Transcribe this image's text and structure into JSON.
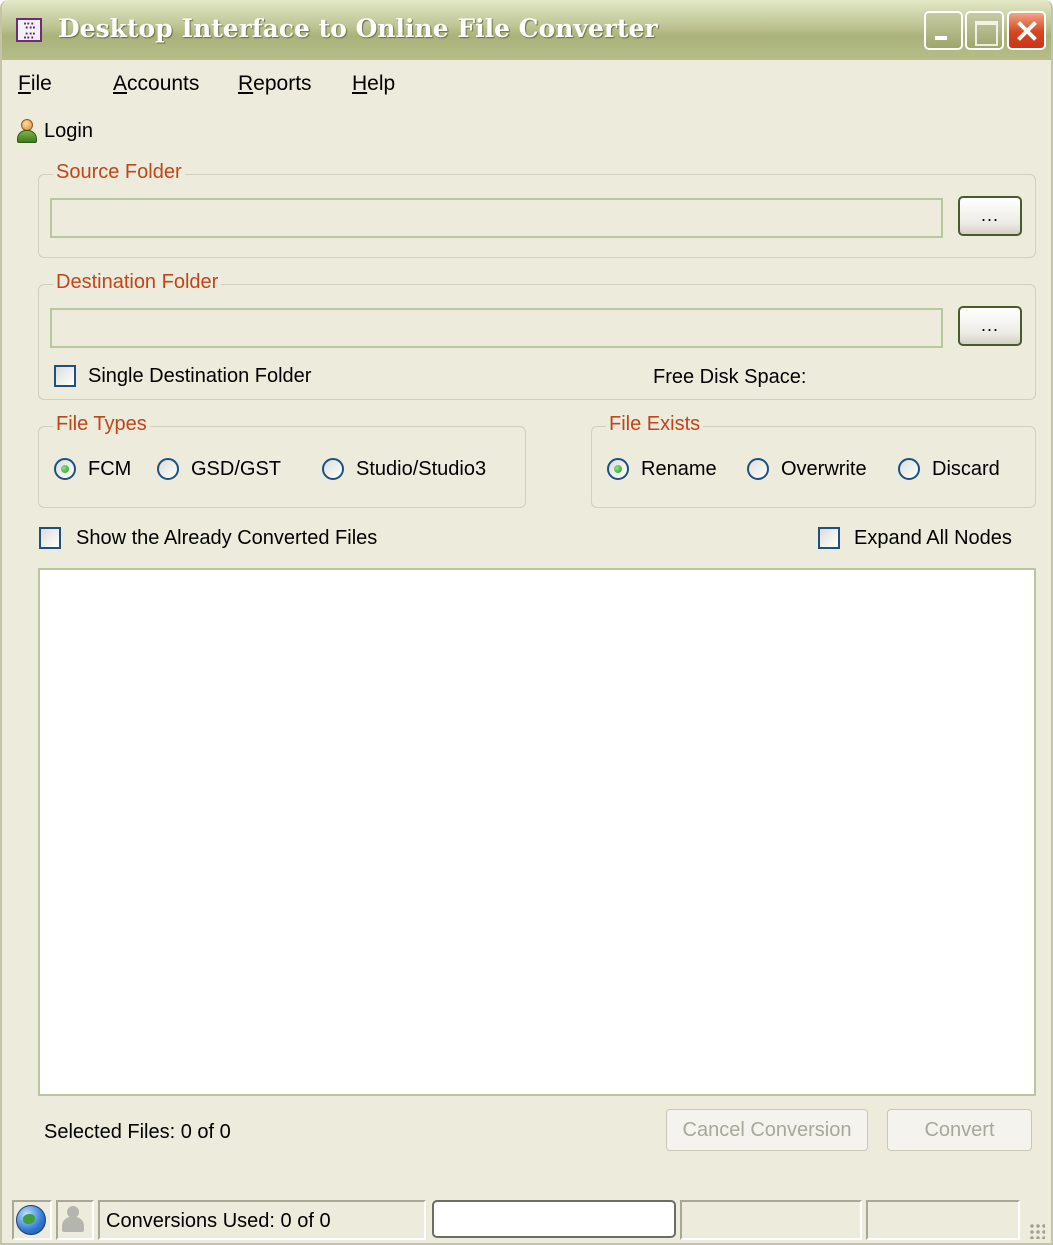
{
  "window": {
    "title": "Desktop Interface to Online File Converter"
  },
  "menu": {
    "items": [
      "File",
      "Accounts",
      "Reports",
      "Help"
    ]
  },
  "toolbar": {
    "login_label": "Login"
  },
  "source": {
    "group_label": "Source Folder",
    "path_value": "",
    "browse_label": "..."
  },
  "destination": {
    "group_label": "Destination Folder",
    "path_value": "",
    "browse_label": "...",
    "single_folder_label": "Single Destination Folder",
    "single_folder_checked": false,
    "free_disk_label": "Free Disk Space:"
  },
  "file_types": {
    "group_label": "File Types",
    "options": [
      "FCM",
      "GSD/GST",
      "Studio/Studio3"
    ],
    "selected": "FCM"
  },
  "file_exists": {
    "group_label": "File Exists",
    "options": [
      "Rename",
      "Overwrite",
      "Discard"
    ],
    "selected": "Rename"
  },
  "options": {
    "show_converted_label": "Show the Already Converted Files",
    "show_converted_checked": false,
    "expand_nodes_label": "Expand All Nodes",
    "expand_nodes_checked": false
  },
  "footer": {
    "selected_files": "Selected Files: 0 of 0",
    "cancel_label": "Cancel Conversion",
    "convert_label": "Convert"
  },
  "statusbar": {
    "conversions_used": "Conversions Used: 0 of 0"
  },
  "colors": {
    "group_label": "#c2451a",
    "window_bg": "#ecebdc",
    "field_border": "#b8c79e",
    "disabled_text": "#a8a79c"
  }
}
